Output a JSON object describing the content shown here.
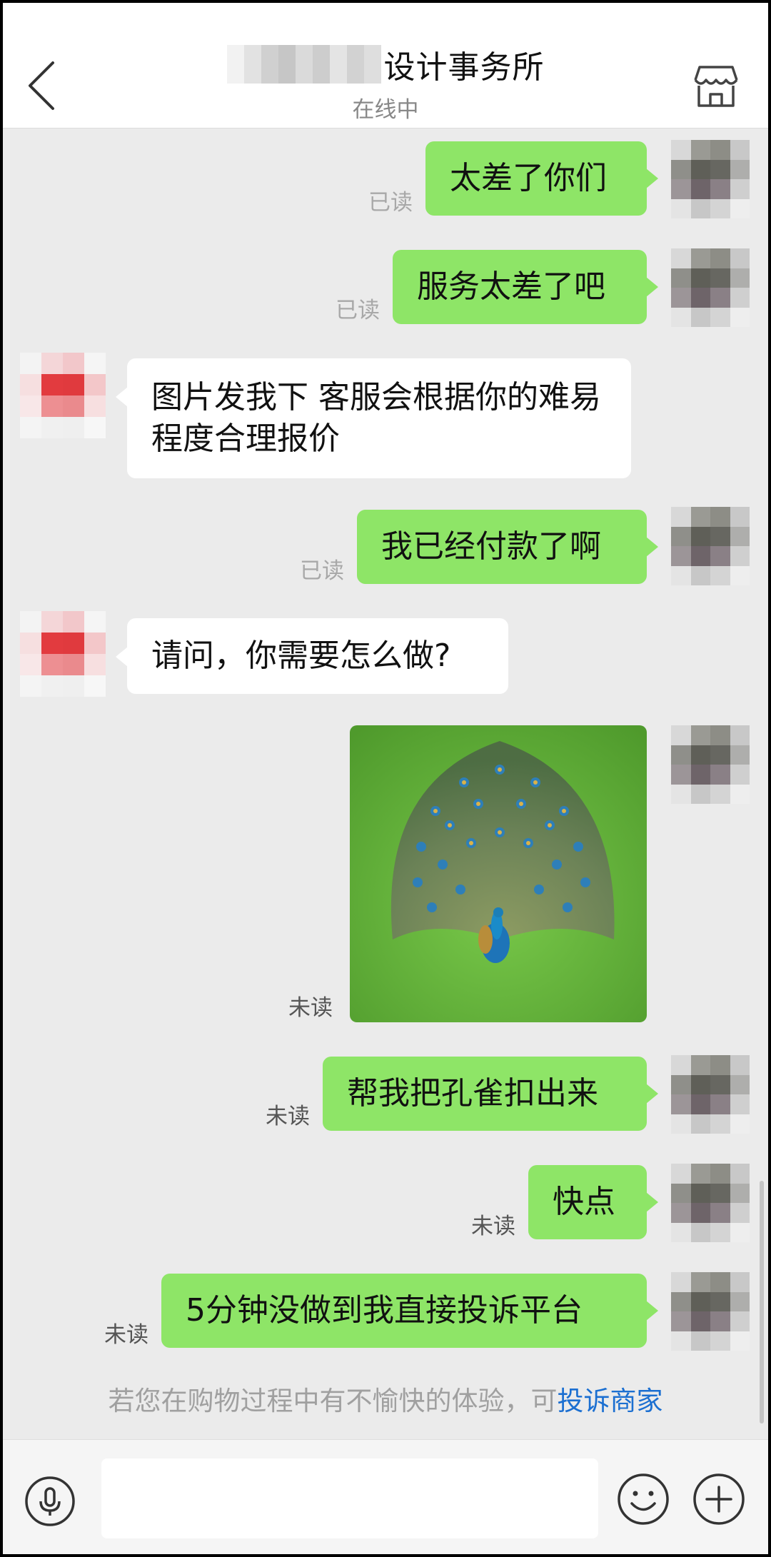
{
  "header": {
    "title": "设计事务所",
    "status": "在线中"
  },
  "messages": [
    {
      "dir": "out",
      "text": "太差了你们",
      "read": "已读"
    },
    {
      "dir": "out",
      "text": "服务太差了吧",
      "read": "已读"
    },
    {
      "dir": "in",
      "text": "图片发我下 客服会根据你的难易程度合理报价"
    },
    {
      "dir": "out",
      "text": "我已经付款了啊",
      "read": "已读"
    },
    {
      "dir": "in",
      "text": "请问，你需要怎么做?"
    },
    {
      "dir": "out",
      "type": "image",
      "read": "未读"
    },
    {
      "dir": "out",
      "text": "帮我把孔雀扣出来",
      "read": "未读"
    },
    {
      "dir": "out",
      "text": "快点",
      "read": "未读"
    },
    {
      "dir": "out",
      "text": "5分钟没做到我直接投诉平台",
      "read": "未读"
    }
  ],
  "notice": {
    "text": "若您在购物过程中有不愉快的体验，可",
    "link": "投诉商家"
  },
  "colors": {
    "outgoing_bubble": "#8ee567",
    "incoming_bubble": "#ffffff",
    "link": "#1b6fd1"
  },
  "icons": {
    "back": "chevron-left-icon",
    "store": "store-icon",
    "voice": "microphone-icon",
    "emoji": "smiley-icon",
    "more": "plus-icon"
  }
}
